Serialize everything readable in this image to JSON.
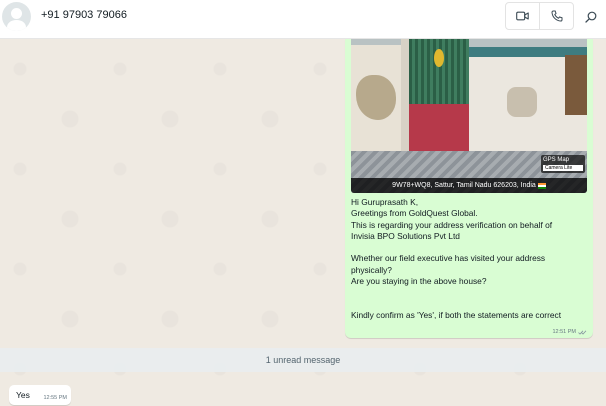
{
  "header": {
    "contact_name": "+91 97903 79066",
    "icons": [
      "avatar-default",
      "video-call-icon",
      "voice-call-icon",
      "search-icon"
    ]
  },
  "outgoing_message": {
    "image_caption": "9W78+WQ8, Sattur, Tamil Nadu 626203, India",
    "gps_badge_title": "GPS Map",
    "gps_badge_sub": "Camera Lite",
    "lines": [
      "Hi Guruprasath K,",
      "Greetings from GoldQuest Global.",
      "This is regarding your address verification on behalf of",
      "Invisia BPO Solutions Pvt Ltd",
      "",
      "Whether our field executive has visited your address",
      "physically?",
      "Are you staying in the above house?",
      "",
      "",
      "Kindly confirm as 'Yes', if both the statements are correct"
    ],
    "time": "12:51 PM"
  },
  "unread_divider": "1 unread message",
  "incoming_message": {
    "text": "Yes",
    "time": "12:55 PM"
  },
  "colors": {
    "outgoing_bubble": "#d9fdd3",
    "incoming_bubble": "#ffffff",
    "chat_background": "#efeae2",
    "tick": "#8696a0"
  }
}
